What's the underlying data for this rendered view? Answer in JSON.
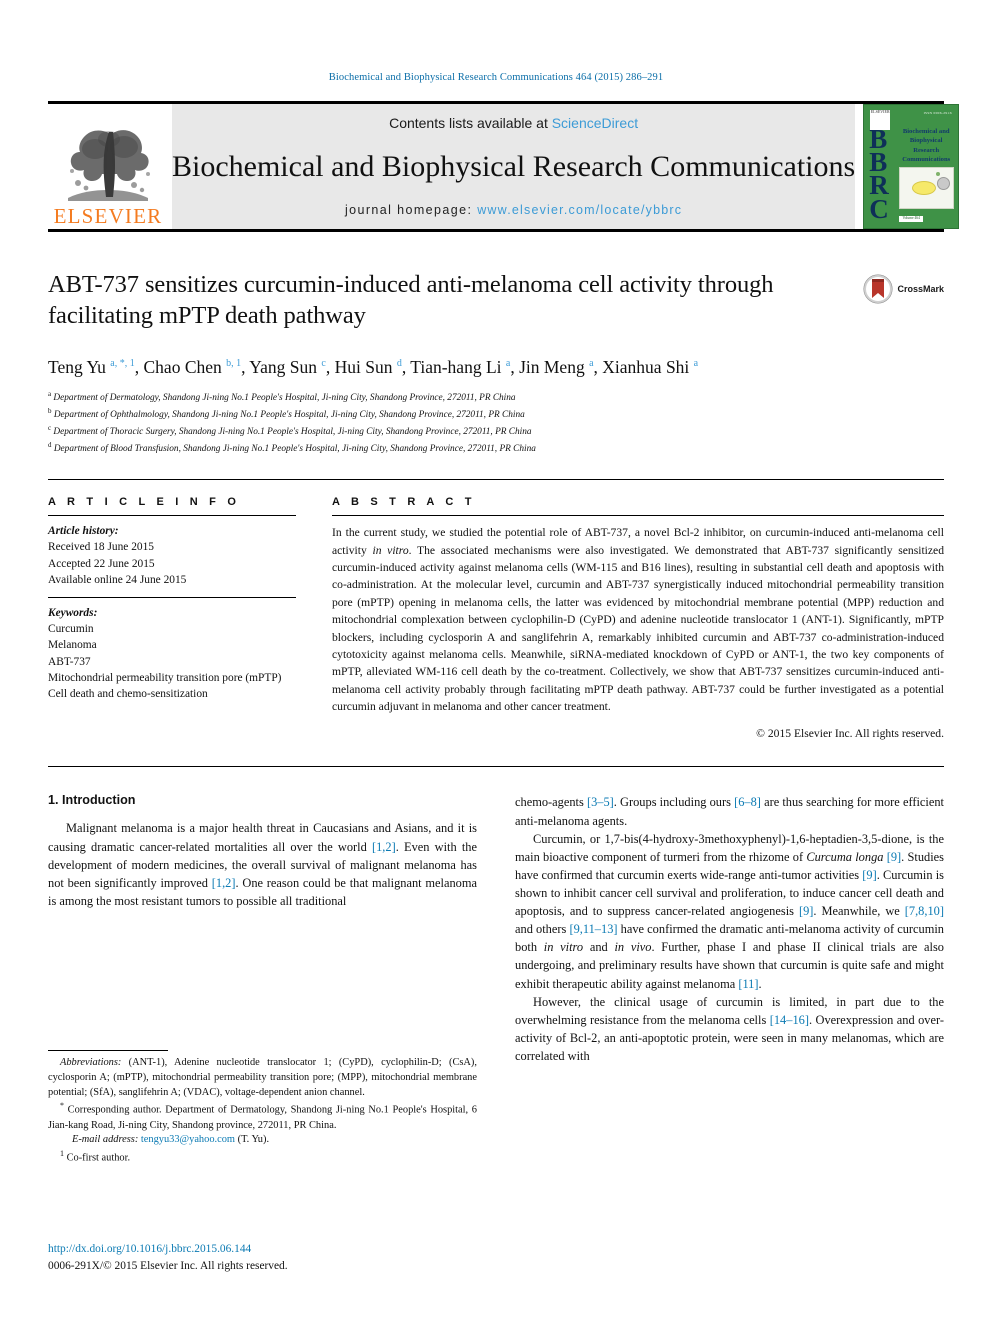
{
  "running_head": "Biochemical and Biophysical Research Communications 464 (2015) 286–291",
  "masthead": {
    "publisher_name": "ELSEVIER",
    "contents_prefix": "Contents lists available at ",
    "contents_link": "ScienceDirect",
    "journal_title": "Biochemical and Biophysical Research Communications",
    "homepage_prefix": "journal homepage: ",
    "homepage_url": "www.elsevier.com/locate/ybbrc",
    "cover": {
      "initials": "BBRC",
      "name_lines": "Biochemical and Biophysical Research Communications",
      "issn_note": "ISSN 0006-291X",
      "volume_note": "Volume 464",
      "publisher_mark": "ELSEVIER"
    }
  },
  "article": {
    "title": "ABT-737 sensitizes curcumin-induced anti-melanoma cell activity through facilitating mPTP death pathway",
    "crossmark_label": "CrossMark",
    "authors": [
      {
        "name": "Teng Yu",
        "marks": "a, *, 1",
        "sep": ", "
      },
      {
        "name": "Chao Chen",
        "marks": "b, 1",
        "sep": ", "
      },
      {
        "name": "Yang Sun",
        "marks": "c",
        "sep": ", "
      },
      {
        "name": "Hui Sun",
        "marks": "d",
        "sep": ", "
      },
      {
        "name": "Tian-hang Li",
        "marks": "a",
        "sep": ", "
      },
      {
        "name": "Jin Meng",
        "marks": "a",
        "sep": ", "
      },
      {
        "name": "Xianhua Shi",
        "marks": "a",
        "sep": ""
      }
    ],
    "affiliations": [
      {
        "mark": "a",
        "text": "Department of Dermatology, Shandong Ji-ning No.1 People's Hospital, Ji-ning City, Shandong Province, 272011, PR China"
      },
      {
        "mark": "b",
        "text": "Department of Ophthalmology, Shandong Ji-ning No.1 People's Hospital, Ji-ning City, Shandong Province, 272011, PR China"
      },
      {
        "mark": "c",
        "text": "Department of Thoracic Surgery, Shandong Ji-ning No.1 People's Hospital, Ji-ning City, Shandong Province, 272011, PR China"
      },
      {
        "mark": "d",
        "text": "Department of Blood Transfusion, Shandong Ji-ning No.1 People's Hospital, Ji-ning City, Shandong Province, 272011, PR China"
      }
    ]
  },
  "article_info": {
    "heading": "A R T I C L E  I N F O",
    "history_label": "Article history:",
    "history": [
      "Received 18 June 2015",
      "Accepted 22 June 2015",
      "Available online 24 June 2015"
    ],
    "keywords_label": "Keywords:",
    "keywords": [
      "Curcumin",
      "Melanoma",
      "ABT-737",
      "Mitochondrial permeability transition pore (mPTP)",
      "Cell death and chemo-sensitization"
    ]
  },
  "abstract": {
    "heading": "A B S T R A C T",
    "text_1": "In the current study, we studied the potential role of ABT-737, a novel Bcl-2 inhibitor, on curcumin-induced anti-melanoma cell activity ",
    "italic_1": "in vitro",
    "text_2": ". The associated mechanisms were also investigated. We demonstrated that ABT-737 significantly sensitized curcumin-induced activity against melanoma cells (WM-115 and B16 lines), resulting in substantial cell death and apoptosis with co-administration. At the molecular level, curcumin and ABT-737 synergistically induced mitochondrial permeability transition pore (mPTP) opening in melanoma cells, the latter was evidenced by mitochondrial membrane potential (MPP) reduction and mitochondrial complexation between cyclophilin-D (CyPD) and adenine nucleotide translocator 1 (ANT-1). Significantly, mPTP blockers, including cyclosporin A and sanglifehrin A, remarkably inhibited curcumin and ABT-737 co-administration-induced cytotoxicity against melanoma cells. Meanwhile, siRNA-mediated knockdown of CyPD or ANT-1, the two key components of mPTP, alleviated WM-116 cell death by the co-treatment. Collectively, we show that ABT-737 sensitizes curcumin-induced anti-melanoma cell activity probably through facilitating mPTP death pathway. ABT-737 could be further investigated as a potential curcumin adjuvant in melanoma and other cancer treatment.",
    "copyright": "© 2015 Elsevier Inc. All rights reserved."
  },
  "introduction": {
    "section_number_title": "1.  Introduction",
    "left_para_1_a": "Malignant melanoma is a major health threat in Caucasians and Asians, and it is causing dramatic cancer-related mortalities all over the world ",
    "left_ref_1": "[1,2]",
    "left_para_1_b": ". Even with the development of modern medicines, the overall survival of malignant melanoma has not been significantly improved ",
    "left_ref_2": "[1,2]",
    "left_para_1_c": ". One reason could be that malignant melanoma is among the most resistant tumors to possible all traditional",
    "right_para_1_a": "chemo-agents ",
    "right_ref_1": "[3–5]",
    "right_para_1_b": ". Groups including ours ",
    "right_ref_2": "[6–8]",
    "right_para_1_c": " are thus searching for more efficient anti-melanoma agents.",
    "right_para_2_a": "Curcumin, or 1,7-bis(4-hydroxy-3methoxyphenyl)-1,6-heptadien-3,5-dione, is the main bioactive component of turmeri from the rhizome of ",
    "right_italic_1": "Curcuma longa",
    "right_para_2_b": " ",
    "right_ref_3": "[9]",
    "right_para_2_c": ". Studies have confirmed that curcumin exerts wide-range anti-tumor activities ",
    "right_ref_4": "[9]",
    "right_para_2_d": ". Curcumin is shown to inhibit cancer cell survival and proliferation, to induce cancer cell death and apoptosis, and to suppress cancer-related angiogenesis ",
    "right_ref_5": "[9]",
    "right_para_2_e": ". Meanwhile, we ",
    "right_ref_6": "[7,8,10]",
    "right_para_2_f": " and others ",
    "right_ref_7": "[9,11–13]",
    "right_para_2_g": " have confirmed the dramatic anti-melanoma activity of curcumin both ",
    "right_italic_2": "in vitro",
    "right_para_2_h": " and ",
    "right_italic_3": "in vivo",
    "right_para_2_i": ". Further, phase I and phase II clinical trials are also undergoing, and preliminary results have shown that curcumin is quite safe and might exhibit therapeutic ability against melanoma ",
    "right_ref_8": "[11]",
    "right_para_2_j": ".",
    "right_para_3_a": "However, the clinical usage of curcumin is limited, in part due to the overwhelming resistance from the melanoma cells ",
    "right_ref_9": "[14–16]",
    "right_para_3_b": ". Overexpression and over-activity of Bcl-2, an anti-apoptotic protein, were seen in many melanomas, which are correlated with"
  },
  "footnotes": {
    "abbrev_label": "Abbreviations:",
    "abbrev_text": " (ANT-1), Adenine nucleotide translocator 1; (CyPD), cyclophilin-D; (CsA), cyclosporin A; (mPTP), mitochondrial permeability transition pore; (MPP), mitochondrial membrane potential; (SfA), sanglifehrin A; (VDAC), voltage-dependent anion channel.",
    "corresponding_mark": "*",
    "corresponding_text": " Corresponding author. Department of Dermatology, Shandong Ji-ning No.1 People's Hospital, 6 Jian-kang Road, Ji-ning City, Shandong province, 272011, PR China.",
    "email_label": "E-mail address:",
    "email_value": "tengyu33@yahoo.com",
    "email_suffix": " (T. Yu).",
    "cofirst_mark": "1",
    "cofirst_text": " Co-first author."
  },
  "footer": {
    "doi_url": "http://dx.doi.org/10.1016/j.bbrc.2015.06.144",
    "issn_copyright": "0006-291X/© 2015 Elsevier Inc. All rights reserved."
  },
  "colors": {
    "link_blue": "#0b7ab3",
    "sciencedirect_blue": "#3c9bd6",
    "elsevier_orange": "#f47b20",
    "cover_green": "#3f9247",
    "crossmark_red": "#b8352a"
  }
}
